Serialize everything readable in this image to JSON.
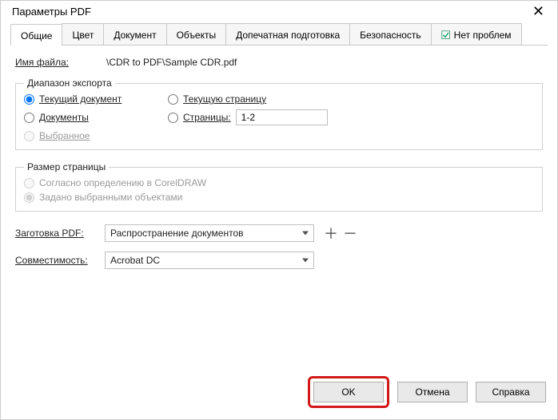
{
  "window": {
    "title": "Параметры PDF"
  },
  "tabs": {
    "general": "Общие",
    "color": "Цвет",
    "document": "Документ",
    "objects": "Объекты",
    "prepress": "Допечатная подготовка",
    "security": "Безопасность",
    "noproblems": "Нет проблем"
  },
  "filerow": {
    "label": "Имя файла:",
    "value": "\\CDR to PDF\\Sample CDR.pdf"
  },
  "export_range": {
    "legend": "Диапазон экспорта",
    "current_doc": "Текущий документ",
    "current_page": "Текущую страницу",
    "documents": "Документы",
    "pages_label": "Страницы:",
    "pages_value": "1-2",
    "selection": "Выбранное"
  },
  "page_size": {
    "legend": "Размер страницы",
    "by_corel": "Согласно определению в CorelDRAW",
    "by_objects": "Задано выбранными объектами"
  },
  "preset": {
    "label": "Заготовка PDF:",
    "value": "Распространение документов"
  },
  "compat": {
    "label": "Совместимость:",
    "value": "Acrobat DC"
  },
  "buttons": {
    "ok": "OK",
    "cancel": "Отмена",
    "help": "Справка"
  }
}
